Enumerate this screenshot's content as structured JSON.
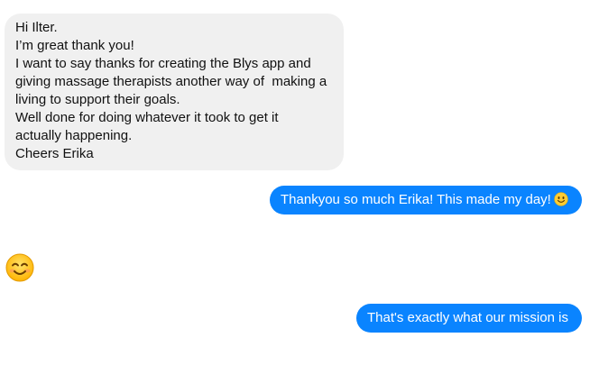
{
  "conversation": {
    "incoming_message": {
      "lines": [
        "Hi Ilter.",
        "I’m great thank you!",
        "I want to say thanks for creating the Blys app and",
        "giving massage therapists another way of  making a",
        "living to support their goals.",
        "Well done for doing whatever it took to get it",
        "actually happening.",
        "Cheers Erika"
      ]
    },
    "outgoing_message_1": {
      "text": "Thankyou so much Erika! This made my day!",
      "emoji": "slightly-smiling-face-icon"
    },
    "reaction_emoji": {
      "emoji": "smiling-face-with-smiling-eyes-icon"
    },
    "outgoing_message_2": {
      "text": "That's exactly what our mission is"
    }
  },
  "colors": {
    "incoming_bubble": "#f0f0f0",
    "outgoing_bubble": "#0a84ff",
    "outgoing_text": "#ffffff",
    "emoji_yellow": "#ffcc33"
  }
}
